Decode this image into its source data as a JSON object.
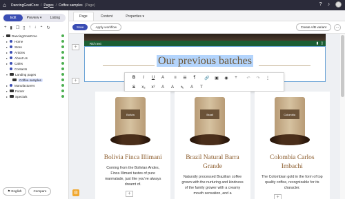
{
  "topbar": {
    "app_name": "DancingGoatCore",
    "crumb_pages": "Pages",
    "crumb_current": "Coffee samples",
    "crumb_type": "(Page)",
    "icons": [
      "home-icon",
      "help-icon",
      "bell-icon",
      "avatar"
    ]
  },
  "sidebar": {
    "modes": [
      "Edit",
      "Preview",
      "Listing"
    ],
    "active_mode": "Edit",
    "preview_chevron": "▾",
    "toolbar_icons": [
      "plus-icon",
      "delete-icon",
      "copy-icon",
      "move-icon",
      "up-icon",
      "down-icon",
      "collapse-icon",
      "refresh-icon"
    ],
    "tree": [
      {
        "label": "DancingGoatCore",
        "level": 0,
        "type": "folder"
      },
      {
        "label": "Home",
        "level": 1,
        "type": "page"
      },
      {
        "label": "Store",
        "level": 1,
        "type": "page"
      },
      {
        "label": "Articles",
        "level": 1,
        "type": "page"
      },
      {
        "label": "About Us",
        "level": 1,
        "type": "page"
      },
      {
        "label": "Cafes",
        "level": 1,
        "type": "page"
      },
      {
        "label": "Contacts",
        "level": 1,
        "type": "page"
      },
      {
        "label": "Landing pages",
        "level": 1,
        "type": "folder"
      },
      {
        "label": "Coffee samples",
        "level": 2,
        "type": "page",
        "selected": true
      },
      {
        "label": "Manufacturers",
        "level": 1,
        "type": "page"
      },
      {
        "label": "Footer",
        "level": 1,
        "type": "folder"
      },
      {
        "label": "Specials",
        "level": 1,
        "type": "folder"
      }
    ],
    "language": "English",
    "compare": "Compare"
  },
  "tabs": [
    "Page",
    "Content",
    "Properties"
  ],
  "properties_chevron": "▾",
  "active_tab": "Page",
  "actions": {
    "save": "Save",
    "workflow": "Apply workflow",
    "ab": "Create A/B variant",
    "more": "···"
  },
  "editor": {
    "widget_label": "Rich text",
    "heading": "Our previous batches",
    "format_row1": [
      "B",
      "I",
      "U",
      "A",
      "≡",
      "☰",
      "¶",
      "🔗",
      "▣",
      "◉",
      "+",
      "↶",
      "↷",
      "⋮"
    ],
    "format_row2": [
      "S",
      "x₂",
      "x²",
      "A",
      "A",
      "✎",
      "A",
      "T"
    ]
  },
  "products": [
    {
      "label": "Bolivia",
      "name": "Bolivia Finca Illimani",
      "desc": "Coming from the Bolivian Andes, Finca Illimani tastes of pure marmalade, just like you've always dreamt of."
    },
    {
      "label": "Brazil",
      "name": "Brazil Natural Barra Grande",
      "desc": "Naturally processed Brazilian coffee grown with the nurturing and kindness of the family grower with a creamy mouth sensation, and a"
    },
    {
      "label": "Colombia",
      "name": "Colombia Carlos Imbachi",
      "desc": "The Colombian gold in the form of top quality coffee, recognizable for its character."
    }
  ],
  "colors": {
    "accent": "#3a4db4",
    "topbar": "#2b2b3a",
    "heading": "#6a5434",
    "product_name": "#8a5a2a",
    "edit_bar": "#1b5e34"
  }
}
